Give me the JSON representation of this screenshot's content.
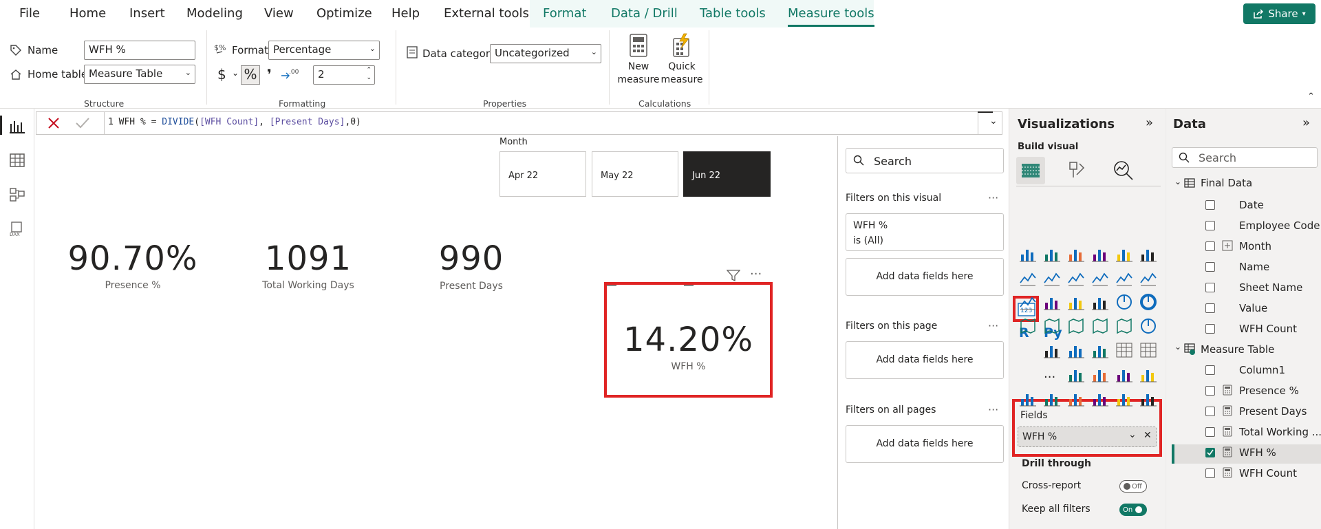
{
  "menu": {
    "items": [
      "File",
      "Home",
      "Insert",
      "Modeling",
      "View",
      "Optimize",
      "Help",
      "External tools"
    ],
    "context_tabs": [
      "Format",
      "Data / Drill",
      "Table tools",
      "Measure tools"
    ],
    "share": "Share"
  },
  "ribbon": {
    "name_label": "Name",
    "name_value": "WFH %",
    "home_table_label": "Home table",
    "home_table_value": "Measure Table",
    "structure_group": "Structure",
    "format_label": "Format",
    "format_value": "Percentage",
    "currency_symbol": "$",
    "percent_symbol": "%",
    "comma_symbol": "❜",
    "decimals_value": "2",
    "formatting_group": "Formatting",
    "data_category_label": "Data category",
    "data_category_value": "Uncategorized",
    "properties_group": "Properties",
    "new_measure_l1": "New",
    "new_measure_l2": "measure",
    "quick_measure_l1": "Quick",
    "quick_measure_l2": "measure",
    "calculations_group": "Calculations"
  },
  "formula": {
    "line_no": "1",
    "measure": "WFH % = ",
    "func": "DIVIDE",
    "open": "(",
    "arg1": "[WFH Count]",
    "comma1": ", ",
    "arg2": "[Present Days]",
    "tail": ",0)"
  },
  "canvas": {
    "slicer_title": "Month",
    "slicer_options": [
      "Apr 22",
      "May 22",
      "Jun 22"
    ],
    "selected_option": "Jun 22",
    "cards": [
      {
        "value": "90.70%",
        "label": "Presence %"
      },
      {
        "value": "1091",
        "label": "Total Working Days"
      },
      {
        "value": "990",
        "label": "Present Days"
      }
    ],
    "selected_card": {
      "value": "14.20%",
      "label": "WFH %"
    }
  },
  "filters": {
    "search_placeholder": "Search",
    "on_visual": "Filters on this visual",
    "visual_filter_name": "WFH %",
    "visual_filter_state": "is (All)",
    "add_fields": "Add data fields here",
    "on_page": "Filters on this page",
    "on_all_pages": "Filters on all pages",
    "more": "···"
  },
  "viz": {
    "title": "Visualizations",
    "build_visual": "Build visual",
    "fields_label": "Fields",
    "field_value": "WFH %",
    "drill_through": "Drill through",
    "cross_report": "Cross-report",
    "cross_report_state": "Off",
    "keep_filters": "Keep all filters",
    "keep_filters_state": "On",
    "r_label": "R",
    "py_label": "Py",
    "more": "···"
  },
  "data": {
    "title": "Data",
    "search_placeholder": "Search",
    "tables": [
      {
        "name": "Final Data",
        "fields": [
          "Date",
          "Employee Code",
          "Month",
          "Name",
          "Sheet Name",
          "Value",
          "WFH Count"
        ]
      },
      {
        "name": "Measure Table",
        "fields": [
          "Column1",
          "Presence %",
          "Present Days",
          "Total Working ...",
          "WFH %",
          "WFH Count"
        ]
      }
    ]
  },
  "colors": {
    "accent": "#117865",
    "highlight_box": "#e02424",
    "selected_slicer": "#252423"
  }
}
